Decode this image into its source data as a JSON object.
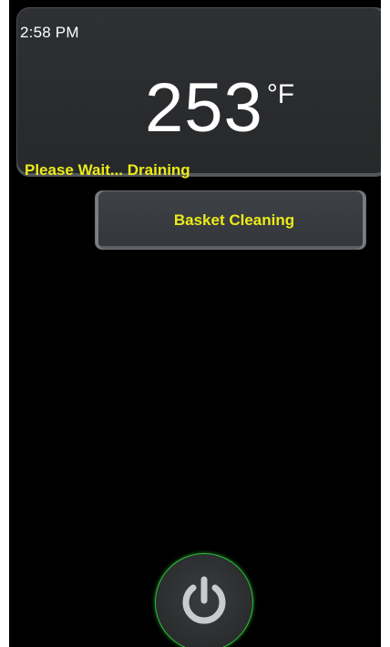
{
  "status_panel": {
    "time": "2:58 PM",
    "temperature": "253",
    "unit": "°F",
    "message": "Please Wait... Draining"
  },
  "basket_button": {
    "label": "Basket Cleaning"
  },
  "power_button": {
    "icon": "power-icon"
  },
  "colors": {
    "accent_yellow": "#ecea1a",
    "power_ring_green": "#2fbf39",
    "background": "#000000",
    "panel": "#2e3033"
  }
}
